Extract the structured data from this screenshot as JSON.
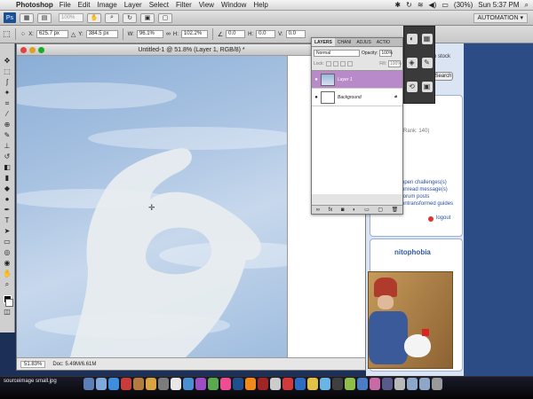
{
  "menubar": {
    "app_name": "Photoshop",
    "items": [
      "File",
      "Edit",
      "Image",
      "Layer",
      "Select",
      "Filter",
      "View",
      "Window",
      "Help"
    ],
    "battery": "(30%)",
    "clock": "Sun 5:37 PM"
  },
  "appbar": {
    "logo": "Ps",
    "zoom": "100%",
    "workspace": "AUTOMATION ▾"
  },
  "options": {
    "x_label": "X:",
    "x_value": "625.7 px",
    "y_label": "Y:",
    "y_value": "384.5 px",
    "w_label": "W:",
    "w_value": "96.1%",
    "h_label": "H:",
    "h_value": "102.2%",
    "angle_value": "0.0",
    "h_skew_label": "H:",
    "h_skew_value": "0.0",
    "v_skew_label": "V:",
    "v_skew_value": "0.0"
  },
  "document": {
    "title": "Untitled-1 @ 51.8% (Layer 1, RGB/8) *",
    "zoom": "51.83%",
    "doc_info": "Doc: 5.49M/6.61M"
  },
  "layers_panel": {
    "tabs": [
      "LAYERS",
      "CHANI",
      "ADJUS",
      "ACTIO"
    ],
    "blend_mode": "Normal",
    "opacity_label": "Opacity:",
    "opacity_value": "100%",
    "lock_label": "Lock:",
    "fill_label": "Fill:",
    "fill_value": "100%",
    "layers": [
      {
        "name": "Layer 1",
        "selected": true
      },
      {
        "name": "Background",
        "selected": false
      }
    ]
  },
  "browser": {
    "search_label": "Search",
    "search_hint": "n stock",
    "rank_text": "(Rank: 140)",
    "links": [
      "open challenges(s)",
      "unread message(s)",
      "forum posts",
      "untransformed guides"
    ],
    "logout": "logout",
    "section_title": "nitophobia"
  },
  "desktop": {
    "file_label": "sourceimage small.jpg"
  },
  "colors": {
    "accent_layer": "#b98ac9",
    "dock_bg": "#050505"
  }
}
